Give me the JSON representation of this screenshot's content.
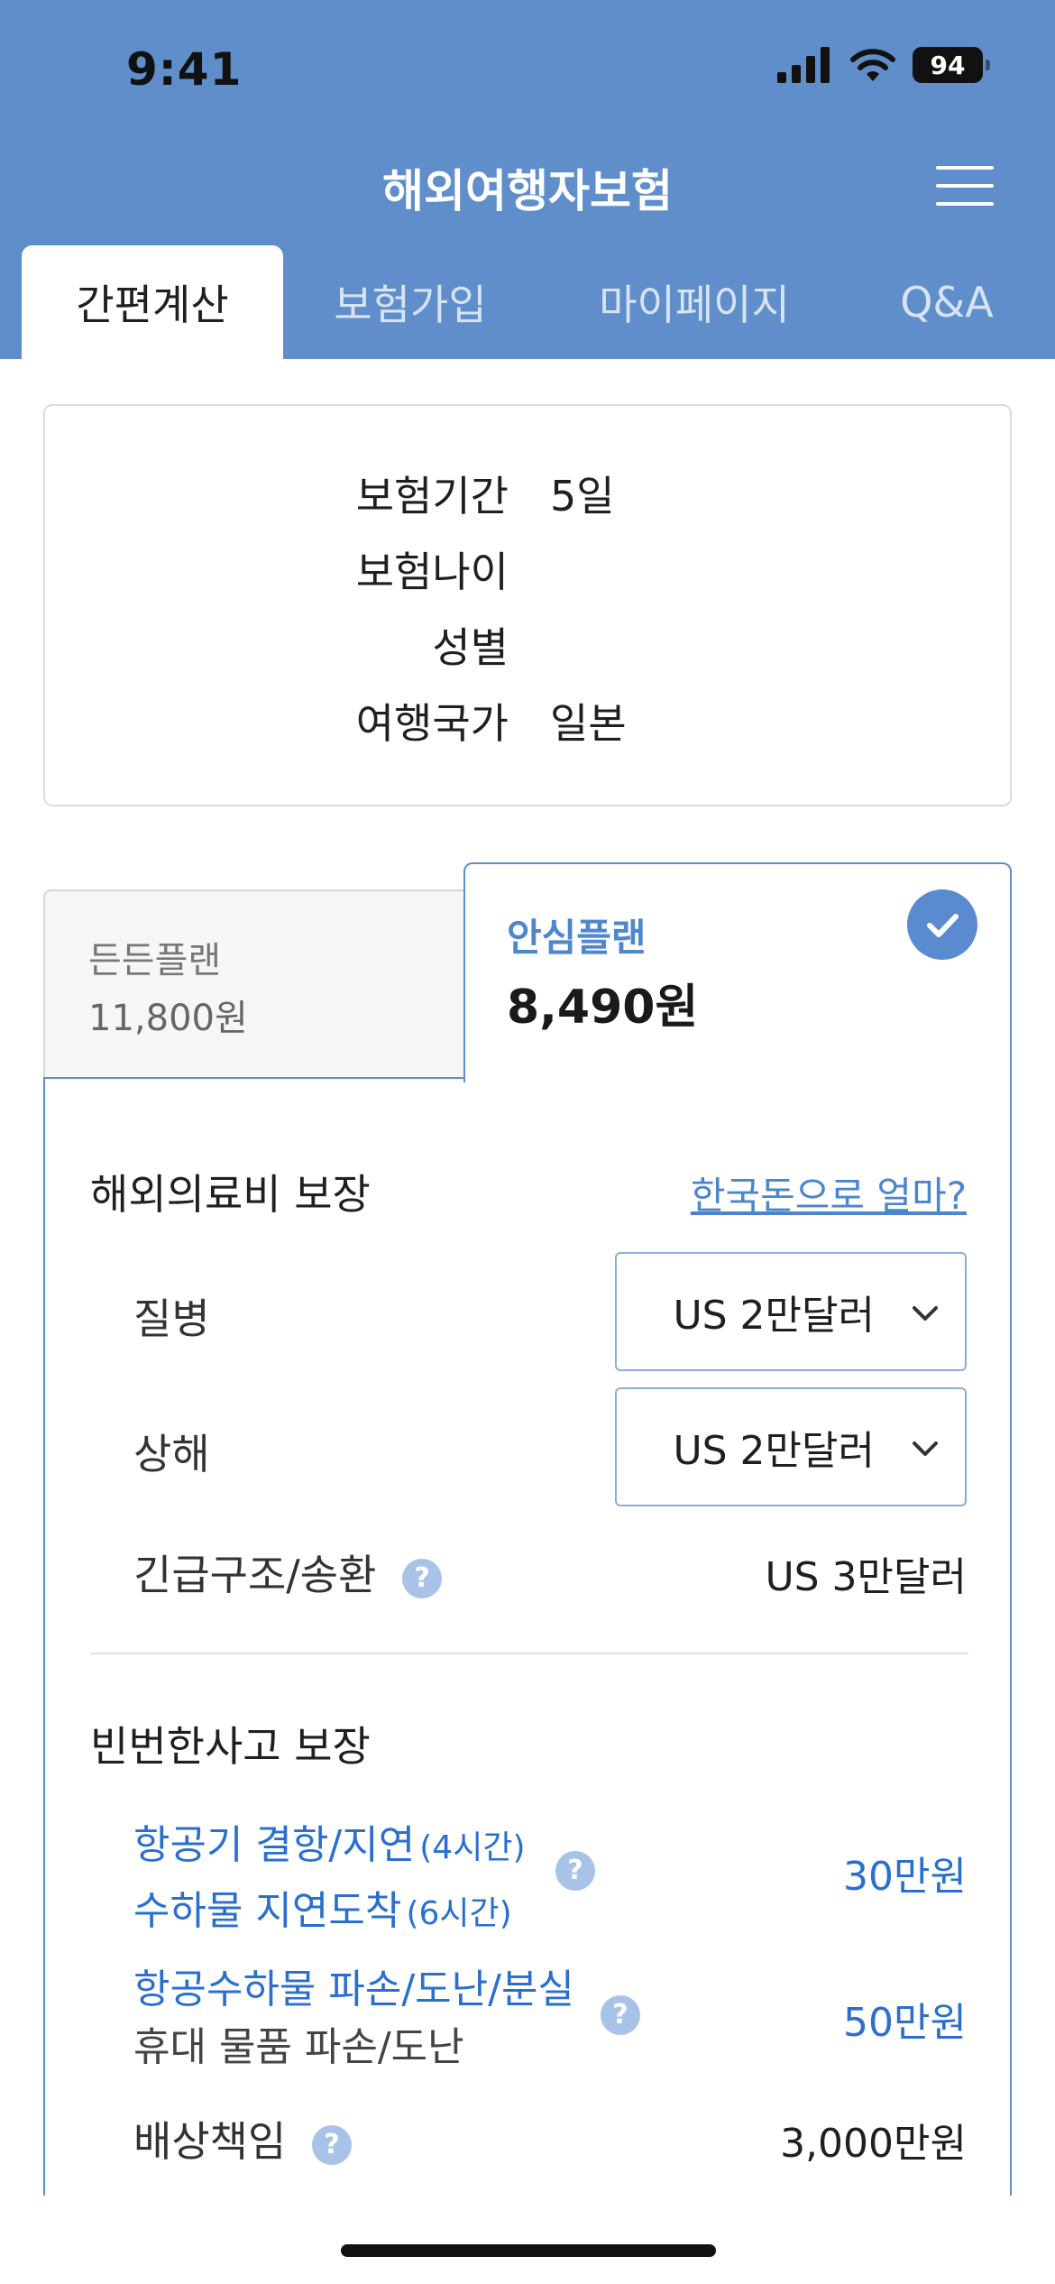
{
  "status_bar": {
    "time": "9:41",
    "battery": "94"
  },
  "header": {
    "title": "해외여행자보험"
  },
  "tabs": [
    {
      "label": "간편계산",
      "active": true
    },
    {
      "label": "보험가입",
      "active": false
    },
    {
      "label": "마이페이지",
      "active": false
    },
    {
      "label": "Q&A",
      "active": false
    }
  ],
  "summary": {
    "rows": [
      {
        "label": "보험기간",
        "value": "5일"
      },
      {
        "label": "보험나이",
        "value": ""
      },
      {
        "label": "성별",
        "value": ""
      },
      {
        "label": "여행국가",
        "value": "일본"
      }
    ]
  },
  "plans": {
    "basic": {
      "name": "든든플랜",
      "price": "11,800원"
    },
    "safe": {
      "name": "안심플랜",
      "price": "8,490원",
      "selected": true
    }
  },
  "medical": {
    "title": "해외의료비 보장",
    "link": "한국돈으로 얼마?",
    "illness": {
      "label": "질병",
      "value": "US 2만달러"
    },
    "injury": {
      "label": "상해",
      "value": "US 2만달러"
    },
    "rescue": {
      "label": "긴급구조/송환",
      "value": "US 3만달러"
    }
  },
  "frequent": {
    "title": "빈번한사고 보장",
    "flight": {
      "line1": "항공기 결항/지연",
      "line1_note": "(4시간)",
      "line2": "수하물 지연도착",
      "line2_note": "(6시간)",
      "value": "30만원"
    },
    "baggage": {
      "line1": "항공수하물 파손/도난/분실",
      "line2": "휴대 물품 파손/도난",
      "value": "50만원"
    },
    "liability": {
      "label": "배상책임",
      "value": "3,000만원"
    }
  },
  "help_symbol": "?",
  "colors": {
    "header": "#5f8ecb",
    "accent": "#4a86cf",
    "link_blue": "#2a6fd0"
  }
}
